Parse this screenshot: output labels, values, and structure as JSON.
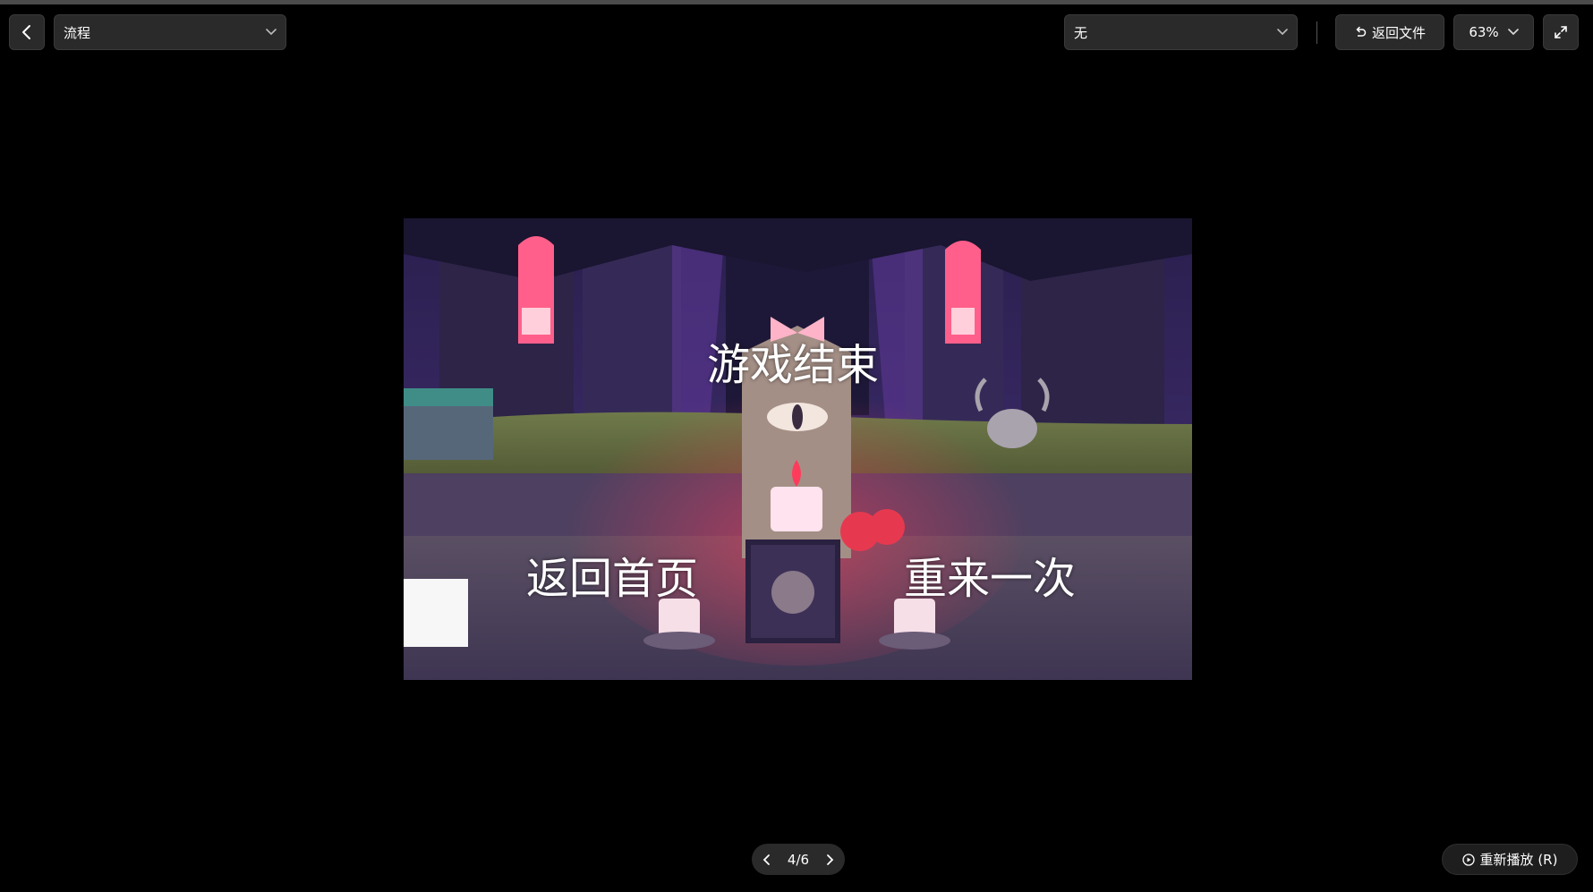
{
  "toolbar": {
    "flow_select_value": "流程",
    "transition_select_value": "无",
    "return_file_label": "返回文件",
    "zoom_label": "63%"
  },
  "canvas": {
    "title_text": "游戏结束",
    "home_button_text": "返回首页",
    "retry_button_text": "重来一次"
  },
  "pager": {
    "page_indicator": "4/6"
  },
  "footer": {
    "replay_label": "重新播放 (R)"
  },
  "icons": {
    "back": "chevron-left-icon",
    "dropdown": "chevron-down-icon",
    "undo": "undo-icon",
    "fullscreen": "expand-icon",
    "prev": "chevron-left-icon",
    "next": "chevron-right-icon",
    "play": "play-circle-icon"
  },
  "colors": {
    "background": "#000000",
    "control_bg": "#2a2a2a",
    "text": "#ffffff"
  }
}
